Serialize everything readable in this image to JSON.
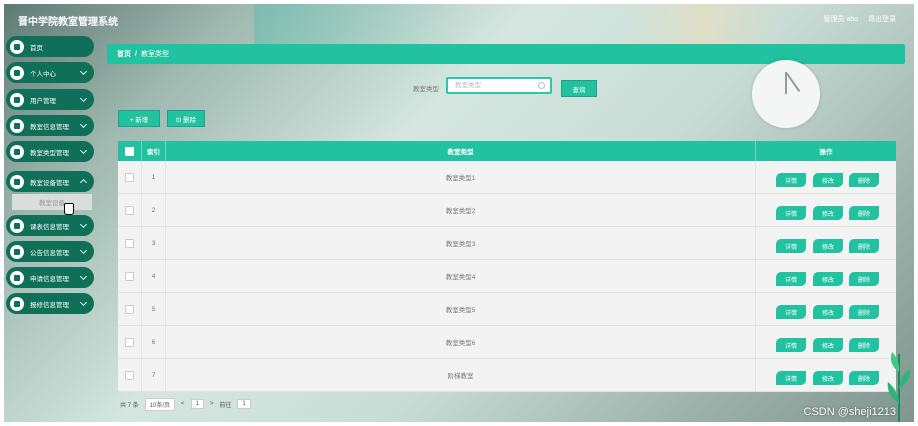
{
  "app": {
    "title": "晋中学院教室管理系统"
  },
  "user": {
    "greeting": "管理员 abo",
    "logout": "退出登录"
  },
  "sidebar": {
    "items": [
      {
        "label": "首页",
        "icon": "home-icon"
      },
      {
        "label": "个人中心",
        "icon": "user-icon"
      },
      {
        "label": "用户管理",
        "icon": "grid-icon"
      },
      {
        "label": "教室信息管理",
        "icon": "list-icon"
      },
      {
        "label": "教室类型管理",
        "icon": "box-icon"
      },
      {
        "label": "教室设备管理",
        "icon": "box-icon"
      },
      {
        "label": "课表信息管理",
        "icon": "grid-icon"
      },
      {
        "label": "公告信息管理",
        "icon": "user-icon"
      },
      {
        "label": "申请信息管理",
        "icon": "flag-icon"
      },
      {
        "label": "报修信息管理",
        "icon": "list-icon"
      }
    ],
    "submenu": {
      "label": "教室设备"
    }
  },
  "breadcrumb": {
    "home": "首页",
    "sep": "/",
    "current": "教室类型"
  },
  "search": {
    "label": "教室类型",
    "placeholder": "教室类型",
    "button": "查询"
  },
  "toolbar": {
    "add": "+ 新增",
    "delete": "⊟ 删除"
  },
  "table": {
    "headers": {
      "index": "索引",
      "type": "教室类型",
      "actions": "操作"
    },
    "rows": [
      {
        "index": "1",
        "type": "教室类型1"
      },
      {
        "index": "2",
        "type": "教室类型2"
      },
      {
        "index": "3",
        "type": "教室类型3"
      },
      {
        "index": "4",
        "type": "教室类型4"
      },
      {
        "index": "5",
        "type": "教室类型5"
      },
      {
        "index": "6",
        "type": "教室类型6"
      },
      {
        "index": "7",
        "type": "阶梯教室"
      }
    ],
    "actions": {
      "detail": "详情",
      "edit": "修改",
      "delete": "删除"
    }
  },
  "pager": {
    "total": "共 7 条",
    "per_page": "10条/页",
    "prev": "<",
    "page": "1",
    "next": ">",
    "goto": "前往",
    "goto_page": "1"
  },
  "watermark": "CSDN @sheji1213",
  "colors": {
    "accent": "#22c19f",
    "sidebar": "#0f6f57"
  }
}
